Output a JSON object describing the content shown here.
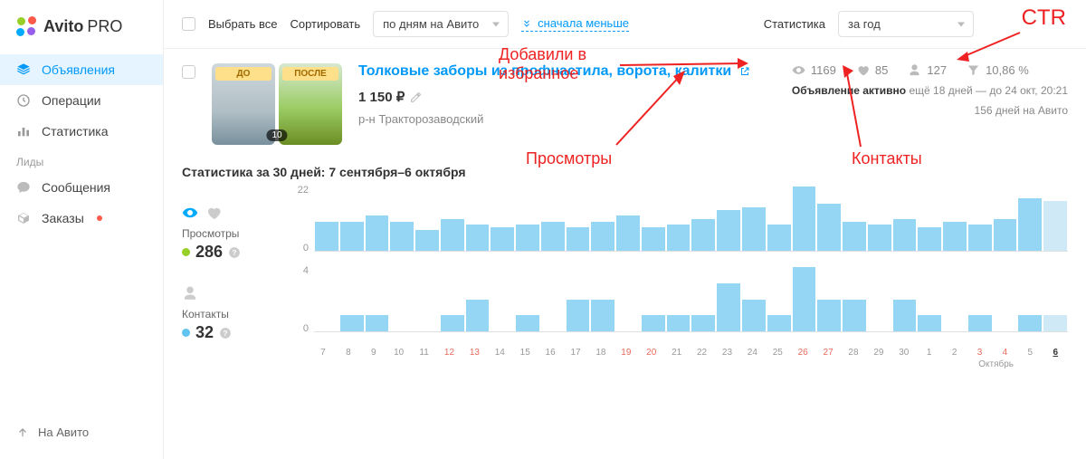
{
  "brand": {
    "name": "Avito",
    "suffix": "PRO"
  },
  "sidebar": {
    "items": [
      {
        "label": "Объявления",
        "icon": "layers-icon",
        "active": true
      },
      {
        "label": "Операции",
        "icon": "history-icon"
      },
      {
        "label": "Статистика",
        "icon": "bars-icon"
      }
    ],
    "section_label": "Лиды",
    "leads": [
      {
        "label": "Сообщения",
        "icon": "chat-icon"
      },
      {
        "label": "Заказы",
        "icon": "box-icon",
        "has_dot": true
      }
    ],
    "footer": {
      "label": "На Авито"
    }
  },
  "toolbar": {
    "select_all": "Выбрать все",
    "sort_label": "Сортировать",
    "sort_select": "по дням на Авито",
    "sort_link": "сначала меньше",
    "stats_label": "Статистика",
    "stats_select": "за год"
  },
  "listing": {
    "thumb1_label": "ДО",
    "thumb2_label": "ПОСЛЕ",
    "thumb_count": "10",
    "title": "Толковые заборы из профнастила, ворота, калитки",
    "price": "1 150 ₽",
    "district": "р-н Тракторозаводский",
    "metrics": {
      "views": "1169",
      "favorites": "85",
      "contacts": "127",
      "ctr": "10,86 %"
    },
    "status_prefix": "Объявление активно",
    "status_rest": " ещё 18 дней — до 24 окт, 20:21",
    "days_on": "156 дней на Авито"
  },
  "stats": {
    "header_prefix": "Статистика за 30 дней:",
    "header_range": "7 сентября–6 октября",
    "views_label": "Просмотры",
    "views_value": "286",
    "contacts_label": "Контакты",
    "contacts_value": "32"
  },
  "annotations": {
    "ctr": "CTR",
    "favorites": "Добавили в\nизбранное",
    "views": "Просмотры",
    "contacts": "Контакты"
  },
  "month_label": "Октябрь",
  "chart_data": [
    {
      "type": "bar",
      "title": "Просмотры (30 дней)",
      "ylim": [
        0,
        22
      ],
      "categories": [
        "7",
        "8",
        "9",
        "10",
        "11",
        "12",
        "13",
        "14",
        "15",
        "16",
        "17",
        "18",
        "19",
        "20",
        "21",
        "22",
        "23",
        "24",
        "25",
        "26",
        "27",
        "28",
        "29",
        "30",
        "1",
        "2",
        "3",
        "4",
        "5",
        "6"
      ],
      "weekend_flags": [
        0,
        0,
        0,
        0,
        0,
        1,
        1,
        0,
        0,
        0,
        0,
        0,
        1,
        1,
        0,
        0,
        0,
        0,
        0,
        1,
        1,
        0,
        0,
        0,
        0,
        0,
        1,
        1,
        0,
        0
      ],
      "values": [
        10,
        10,
        12,
        10,
        7,
        11,
        9,
        8,
        9,
        10,
        8,
        10,
        12,
        8,
        9,
        11,
        14,
        15,
        9,
        22,
        16,
        10,
        9,
        11,
        8,
        10,
        9,
        11,
        18,
        17
      ]
    },
    {
      "type": "bar",
      "title": "Контакты (30 дней)",
      "ylim": [
        0,
        4
      ],
      "categories": [
        "7",
        "8",
        "9",
        "10",
        "11",
        "12",
        "13",
        "14",
        "15",
        "16",
        "17",
        "18",
        "19",
        "20",
        "21",
        "22",
        "23",
        "24",
        "25",
        "26",
        "27",
        "28",
        "29",
        "30",
        "1",
        "2",
        "3",
        "4",
        "5",
        "6"
      ],
      "values": [
        0,
        1,
        1,
        0,
        0,
        1,
        2,
        0,
        1,
        0,
        2,
        2,
        0,
        1,
        1,
        1,
        3,
        2,
        1,
        4,
        2,
        2,
        0,
        2,
        1,
        0,
        1,
        0,
        1,
        1
      ]
    }
  ]
}
